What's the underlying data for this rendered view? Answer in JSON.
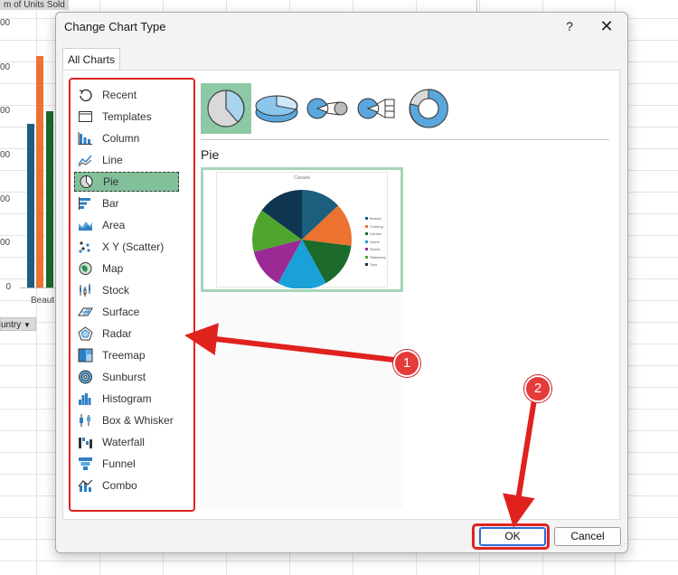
{
  "background": {
    "chart_title": "m of Units Sold",
    "axis_labels": [
      "00",
      "00",
      "00",
      "00",
      "00",
      "00",
      "0"
    ],
    "category_label": "Beaut",
    "filter_label": "untry"
  },
  "dialog": {
    "title": "Change Chart Type",
    "help_label": "?",
    "close_label": "✕",
    "tab_label": "All Charts",
    "chart_types": [
      {
        "label": "Recent",
        "icon": "recent-icon"
      },
      {
        "label": "Templates",
        "icon": "templates-icon"
      },
      {
        "label": "Column",
        "icon": "column-chart-icon"
      },
      {
        "label": "Line",
        "icon": "line-chart-icon"
      },
      {
        "label": "Pie",
        "icon": "pie-chart-icon"
      },
      {
        "label": "Bar",
        "icon": "bar-chart-icon"
      },
      {
        "label": "Area",
        "icon": "area-chart-icon"
      },
      {
        "label": "X Y (Scatter)",
        "icon": "scatter-chart-icon"
      },
      {
        "label": "Map",
        "icon": "map-chart-icon"
      },
      {
        "label": "Stock",
        "icon": "stock-chart-icon"
      },
      {
        "label": "Surface",
        "icon": "surface-chart-icon"
      },
      {
        "label": "Radar",
        "icon": "radar-chart-icon"
      },
      {
        "label": "Treemap",
        "icon": "treemap-chart-icon"
      },
      {
        "label": "Sunburst",
        "icon": "sunburst-chart-icon"
      },
      {
        "label": "Histogram",
        "icon": "histogram-chart-icon"
      },
      {
        "label": "Box & Whisker",
        "icon": "box-whisker-chart-icon"
      },
      {
        "label": "Waterfall",
        "icon": "waterfall-chart-icon"
      },
      {
        "label": "Funnel",
        "icon": "funnel-chart-icon"
      },
      {
        "label": "Combo",
        "icon": "combo-chart-icon"
      }
    ],
    "selected_type": "Pie",
    "subtypes": [
      "pie-subtype-icon",
      "3d-pie-subtype-icon",
      "pie-of-pie-subtype-icon",
      "bar-of-pie-subtype-icon",
      "doughnut-subtype-icon"
    ],
    "subtype_label": "Pie",
    "preview": {
      "title": "Canada",
      "legend": [
        {
          "label": "Beauty",
          "color": "#1b5e7e"
        },
        {
          "label": "Clothing",
          "color": "#ec7230"
        },
        {
          "label": "Garden",
          "color": "#1c6b2c"
        },
        {
          "label": "Home",
          "color": "#1aa1d8"
        },
        {
          "label": "Sports",
          "color": "#9b2a94"
        },
        {
          "label": "Stationery",
          "color": "#4fa52d"
        },
        {
          "label": "Toys",
          "color": "#0f3550"
        }
      ]
    },
    "ok_label": "OK",
    "cancel_label": "Cancel"
  },
  "annotations": {
    "callout_1": "1",
    "callout_2": "2",
    "accent_color": "#e0221f"
  }
}
